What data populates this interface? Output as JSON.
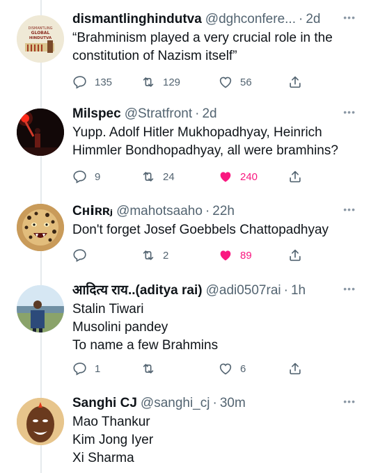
{
  "tweets": [
    {
      "name": "dismantlinghindutva",
      "handle": "@dghconfere...",
      "time": "2d",
      "lines": [
        "“Brahminism played a very crucial role in the",
        "constitution of Nazism itself”"
      ],
      "replies": "135",
      "retweets": "129",
      "likes": "56",
      "liked": false,
      "avatar_text": [
        "DISMANTLING",
        "GLOBAL",
        "HINDUTVA"
      ]
    },
    {
      "name": "Milspec",
      "handle": "@Stratfront",
      "time": "2d",
      "lines": [
        "Yupp. Adolf Hitler Mukhopadhyay, Heinrich",
        "Himmler Bondhopadhyay, all were bramhins?"
      ],
      "replies": "9",
      "retweets": "24",
      "likes": "240",
      "liked": true
    },
    {
      "name": "Cʜⅰʀʀⱼ",
      "handle": "@mahotsaaho",
      "time": "22h",
      "lines": [
        "Don't forget Josef Goebbels Chattopadhyay"
      ],
      "replies": "",
      "retweets": "2",
      "likes": "89",
      "liked": true
    },
    {
      "name": "आदित्य राय..(aditya rai)",
      "handle": "@adi0507rai",
      "time": "1h",
      "lines": [
        "Stalin Tiwari",
        "Musolini pandey",
        "To name a few Brahmins"
      ],
      "replies": "1",
      "retweets": "",
      "likes": "6",
      "liked": false
    },
    {
      "name": "Sanghi CJ",
      "handle": "@sanghi_cj",
      "time": "30m",
      "lines": [
        "Mao Thankur",
        "Kim Jong Iyer",
        "Xi Sharma"
      ]
    }
  ],
  "separator": "·",
  "more": "•••",
  "colors": {
    "text": "#0f1419",
    "muted": "#536471",
    "like_active": "#f91880",
    "thread_line": "#cfd9de"
  },
  "icons": [
    "reply-icon",
    "retweet-icon",
    "like-icon",
    "share-icon",
    "more-icon"
  ]
}
